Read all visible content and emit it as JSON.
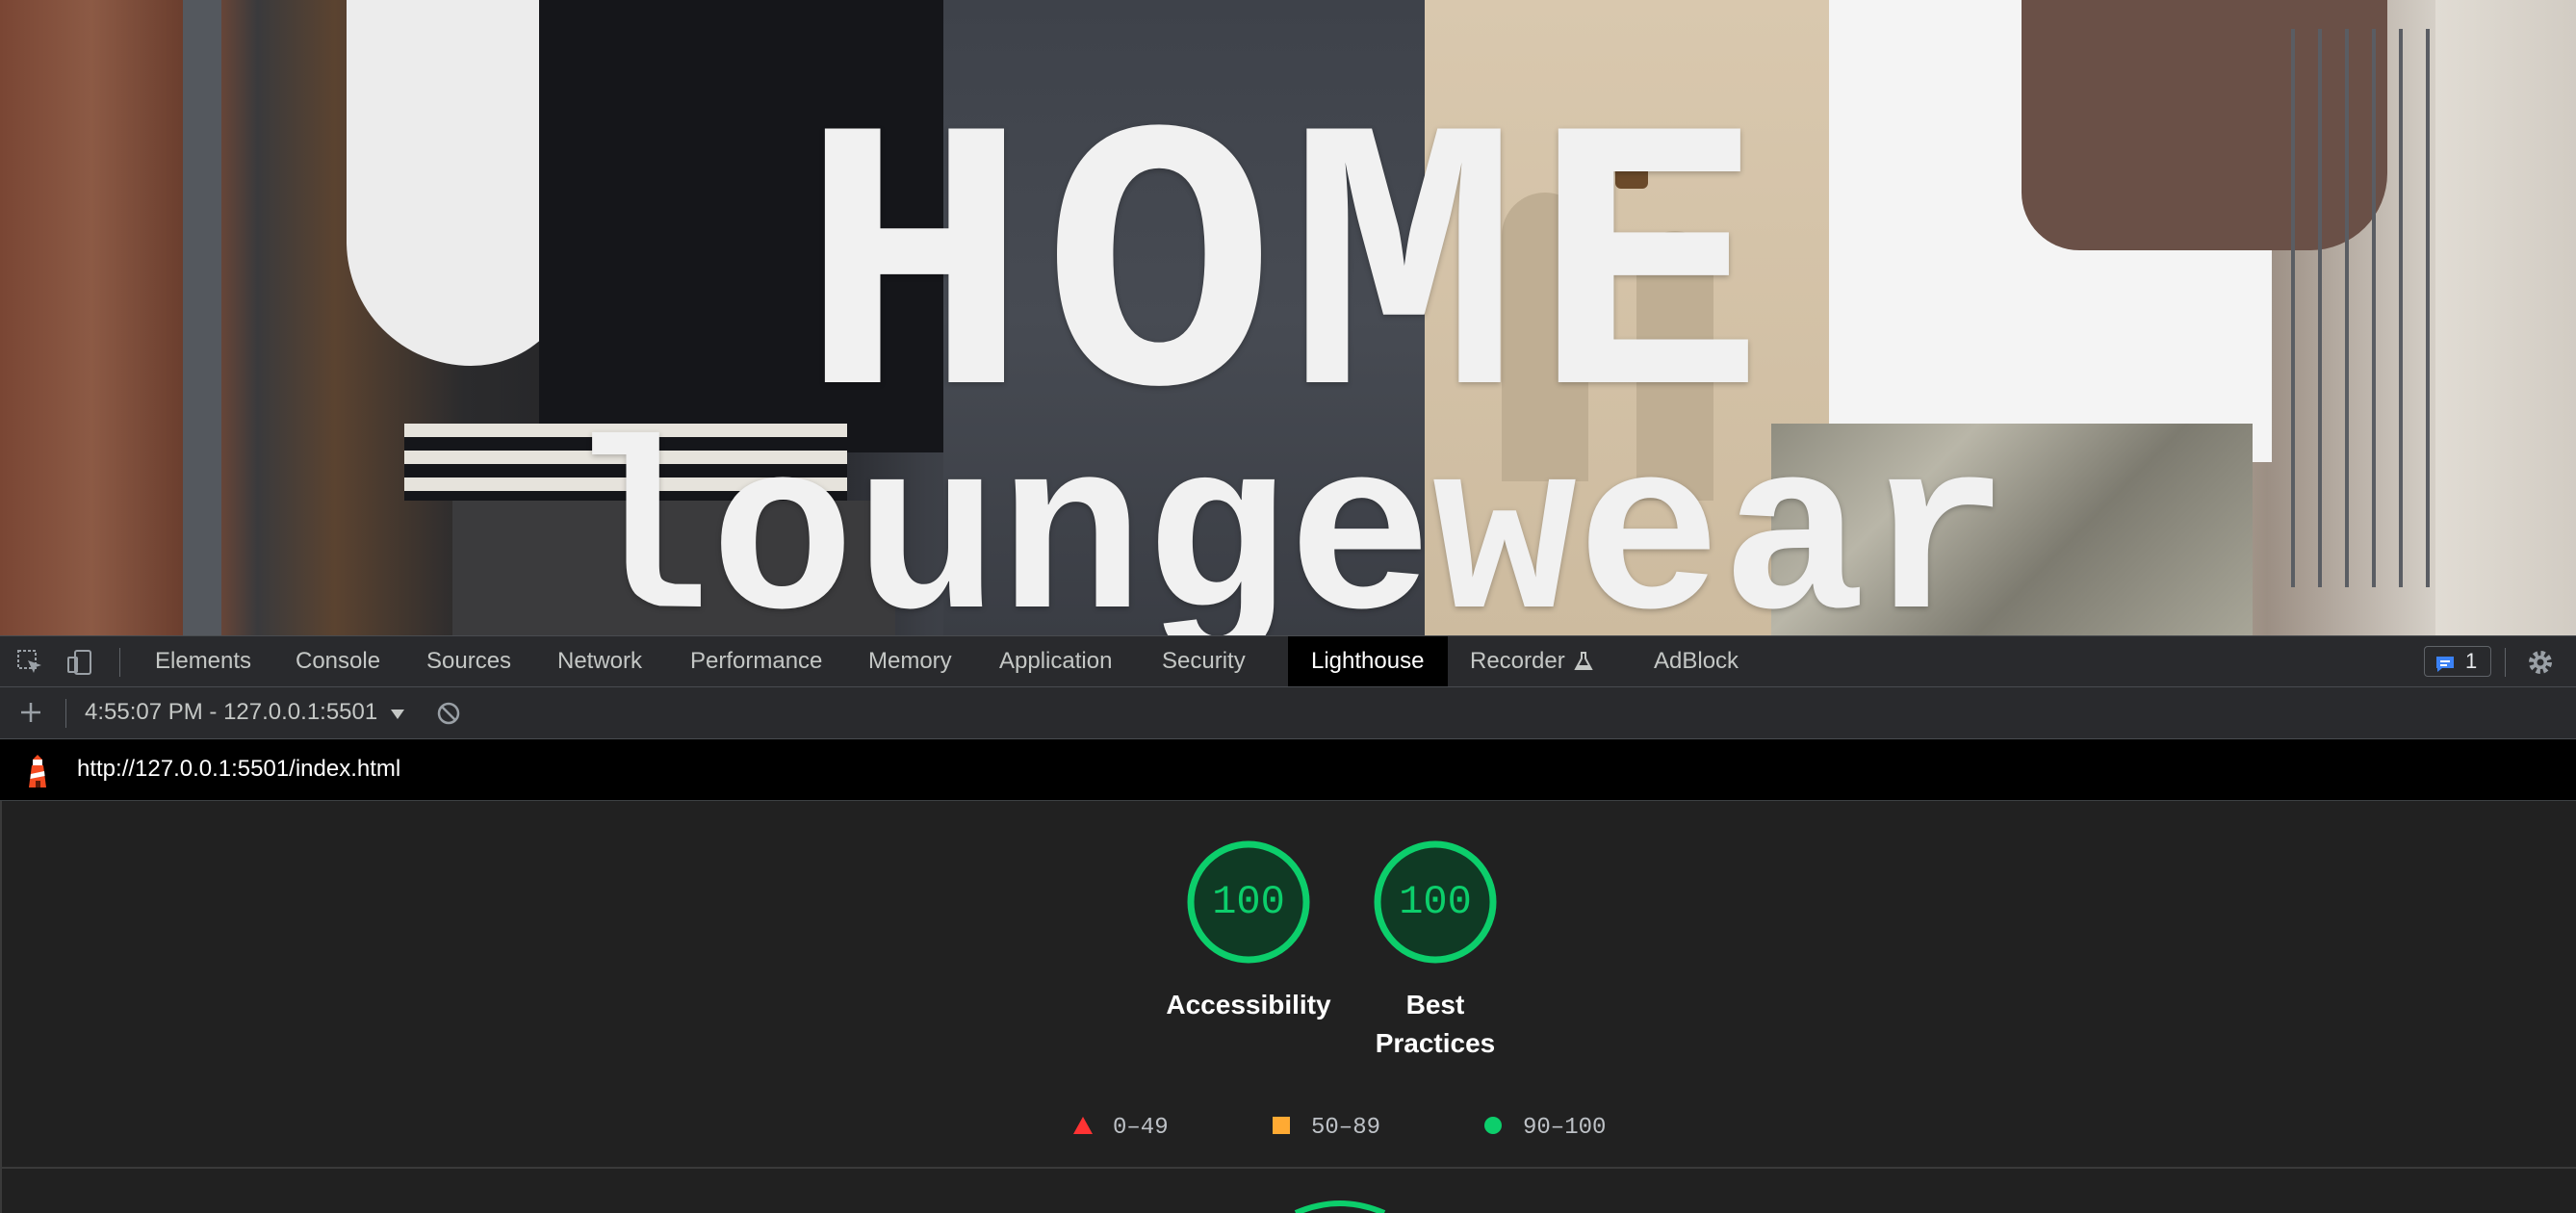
{
  "hero": {
    "title": "HOME",
    "subtitle": "loungewear"
  },
  "devtools": {
    "tabs": [
      {
        "label": "Elements"
      },
      {
        "label": "Console"
      },
      {
        "label": "Sources"
      },
      {
        "label": "Network"
      },
      {
        "label": "Performance"
      },
      {
        "label": "Memory"
      },
      {
        "label": "Application"
      },
      {
        "label": "Security"
      },
      {
        "label": "Lighthouse",
        "active": true
      },
      {
        "label": "Recorder"
      },
      {
        "label": "AdBlock"
      }
    ],
    "issues_count": "1",
    "report_selector": "4:55:07 PM - 127.0.0.1:5501",
    "url": "http://127.0.0.1:5501/index.html"
  },
  "lighthouse": {
    "gauges": [
      {
        "score": "100",
        "label_line1": "Accessibility",
        "label_line2": ""
      },
      {
        "score": "100",
        "label_line1": "Best",
        "label_line2": "Practices"
      }
    ],
    "legend": [
      {
        "shape": "triangle",
        "color": "#ff3333",
        "range": "0–49"
      },
      {
        "shape": "square",
        "color": "#ffaa33",
        "range": "50–89"
      },
      {
        "shape": "circle",
        "color": "#0cce6b",
        "range": "90–100"
      }
    ],
    "pass_color": "#0cce6b"
  },
  "icons": {
    "inspect": "inspect-element-icon",
    "device": "device-toolbar-icon",
    "recorder_flask": "flask-icon",
    "issues": "chat-icon",
    "settings": "gear-icon",
    "add": "plus-icon",
    "caret": "caret-down-icon",
    "clear": "block-icon",
    "lighthouse": "lighthouse-icon"
  }
}
